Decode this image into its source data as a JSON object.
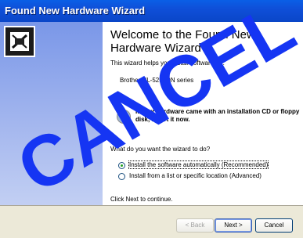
{
  "window": {
    "title": "Found New Hardware Wizard"
  },
  "main": {
    "heading": "Welcome to the Found New Hardware Wizard",
    "intro": "This wizard helps you install software for:",
    "device_name": "Brother HL-5250DN series",
    "cd_prompt": "If your hardware came with an installation CD or floppy disk, insert it now.",
    "question": "What do you want the wizard to do?",
    "options": [
      {
        "label": "Install the software automatically (Recommended)",
        "selected": true
      },
      {
        "label": "Install from a list or specific location (Advanced)",
        "selected": false
      }
    ],
    "continue_text": "Click Next to continue."
  },
  "footer": {
    "back_label": "< Back",
    "next_label": "Next >",
    "cancel_label": "Cancel"
  },
  "overlay": {
    "stamp_text": "CANCEL",
    "stamp_color": "#1535f3"
  },
  "colors": {
    "titlebar": "#0a5fe6",
    "sidebar": "#7a97e8",
    "selected_radio": "#21a121"
  },
  "icons": {
    "wizard": "hardware-wizard-icon",
    "cd": "cd-icon"
  }
}
